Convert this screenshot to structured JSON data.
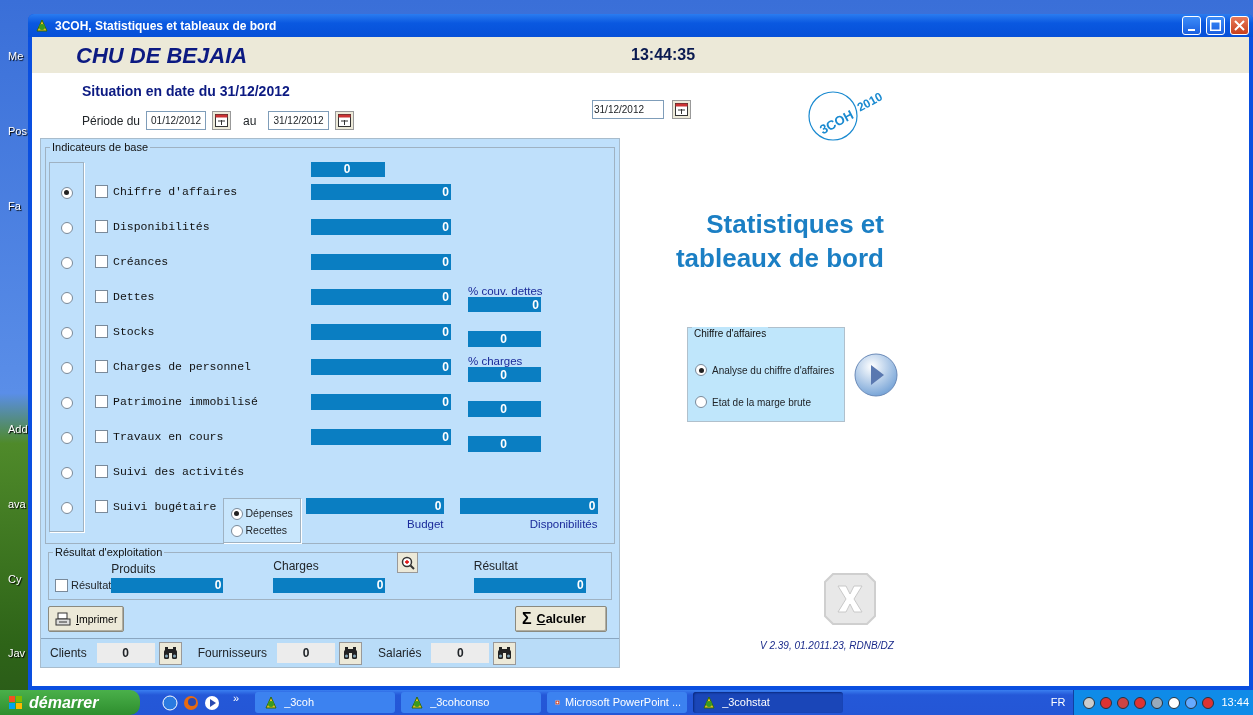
{
  "desktop_icons": [
    {
      "label": "Me"
    },
    {
      "label": "Pos"
    },
    {
      "label": "Fa"
    },
    {
      "label": "Add"
    },
    {
      "label": "ava"
    },
    {
      "label": "Cy"
    },
    {
      "label": "Jav"
    }
  ],
  "window": {
    "title": "3COH, Statistiques et tableaux de bord"
  },
  "header": {
    "organization": "CHU DE BEJAIA",
    "clock": "13:44:35"
  },
  "situation": "Situation en date du 31/12/2012",
  "period": {
    "label_from": "Période du",
    "from": "01/12/2012",
    "label_to": "au",
    "to": "31/12/2012"
  },
  "date_field": "31/12/2012",
  "logo": {
    "name": "3COH",
    "year": "2010"
  },
  "indicators": {
    "title": "Indicateurs de base",
    "header_value": "0",
    "rows": [
      {
        "kind": "value",
        "label": "Chiffre d'affaires",
        "selected": true,
        "checked": false,
        "value": "0"
      },
      {
        "kind": "value",
        "label": "Disponibilités",
        "selected": false,
        "checked": false,
        "value": "0"
      },
      {
        "kind": "value",
        "label": "Créances",
        "selected": false,
        "checked": false,
        "value": "0"
      },
      {
        "kind": "ratio",
        "label": "Dettes",
        "selected": false,
        "checked": false,
        "value": "0",
        "ratio_label": "% couv. dettes",
        "ratio_value": "0"
      },
      {
        "kind": "ratio",
        "label": "Stocks",
        "selected": false,
        "checked": false,
        "value": "0",
        "ratio_value": "0"
      },
      {
        "kind": "ratio",
        "label": "Charges de personnel",
        "selected": false,
        "checked": false,
        "value": "0",
        "ratio_label": "% charges",
        "ratio_value": "0"
      },
      {
        "kind": "ratio",
        "label": "Patrimoine immobilisé",
        "selected": false,
        "checked": false,
        "value": "0",
        "ratio_value": "0"
      },
      {
        "kind": "ratio",
        "label": "Travaux en cours",
        "selected": false,
        "checked": false,
        "value": "0",
        "ratio_value": "0"
      },
      {
        "kind": "plain",
        "label": "Suivi des activités",
        "selected": false,
        "checked": false
      },
      {
        "kind": "budget",
        "label": "Suivi bugétaire",
        "selected": false,
        "checked": false,
        "options": [
          {
            "label": "Dépenses",
            "selected": true
          },
          {
            "label": "Recettes",
            "selected": false
          }
        ],
        "value": "0",
        "value_caption": "Budget",
        "ratio_value": "0",
        "ratio_caption": "Disponibilités"
      }
    ]
  },
  "result": {
    "title": "Résultat d'exploitation",
    "checkbox": {
      "label": "Résultat",
      "checked": false
    },
    "columns": [
      {
        "label": "Produits",
        "value": "0"
      },
      {
        "label": "Charges",
        "value": "0"
      },
      {
        "label": "Résultat",
        "value": "0"
      }
    ]
  },
  "buttons": {
    "print": "Imprimer",
    "calc_symbol": "Σ",
    "calc": "Calculer"
  },
  "counters": [
    {
      "label": "Clients",
      "value": "0"
    },
    {
      "label": "Fournisseurs",
      "value": "0"
    },
    {
      "label": "Salariés",
      "value": "0"
    }
  ],
  "title_lines": [
    "Statistiques et",
    "tableaux de bord"
  ],
  "revenue_group": {
    "title": "Chiffre d'affaires",
    "options": [
      {
        "label": "Analyse du chiffre d'affaires",
        "selected": true
      },
      {
        "label": "Etat de la marge brute",
        "selected": false
      }
    ]
  },
  "version": "V 2.39, 01.2011.23, RDNB/DZ",
  "taskbar": {
    "start": "démarrer",
    "more": "»",
    "tasks": [
      {
        "label": "_3coh",
        "selected": false
      },
      {
        "label": "_3cohconso",
        "selected": false
      },
      {
        "label": "Microsoft PowerPoint ...",
        "selected": false
      },
      {
        "label": "_3cohstat",
        "selected": true
      }
    ],
    "language": "FR",
    "clock": "13:44"
  }
}
